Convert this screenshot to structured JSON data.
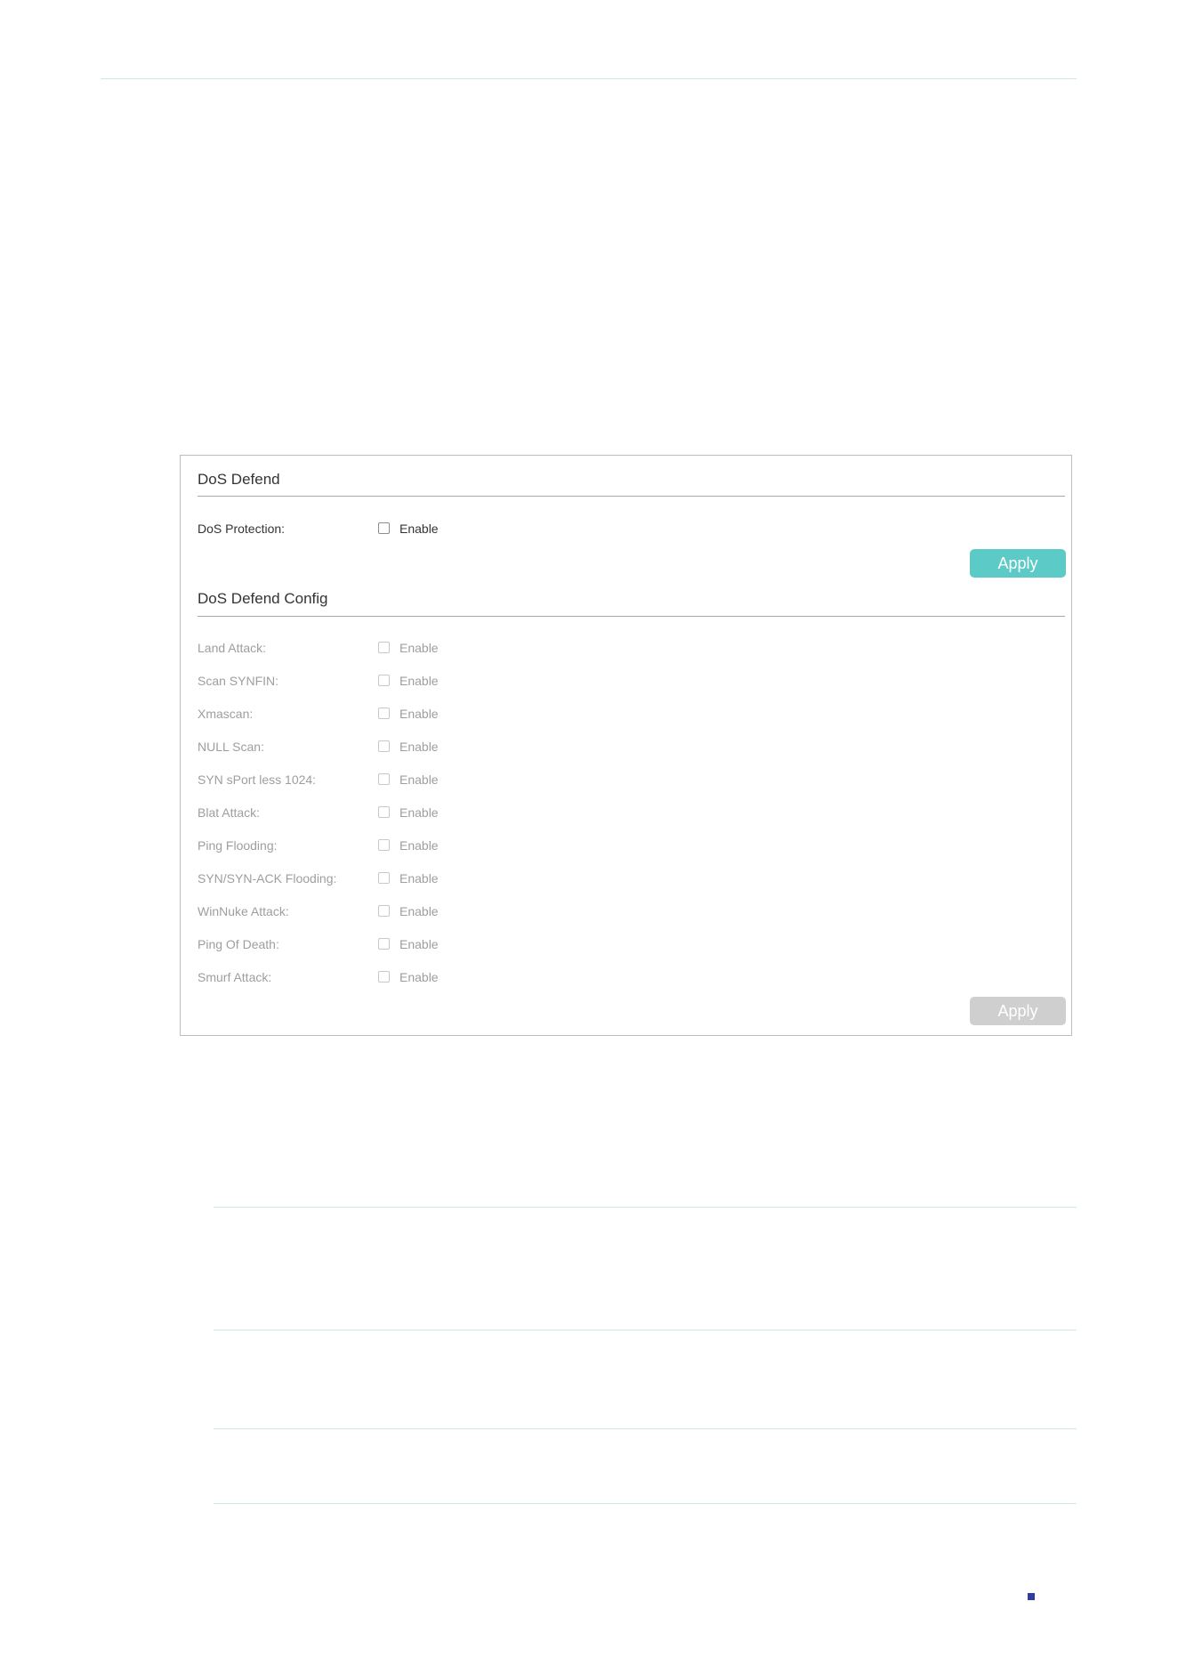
{
  "colors": {
    "accent": "#5ccbc7",
    "disabled_button": "#cfcfcf",
    "divider": "#cfe6ea",
    "page_marker": "#2f3e9e"
  },
  "dos_defend": {
    "title": "DoS Defend",
    "protection": {
      "label": "DoS Protection:",
      "checkbox_label": "Enable",
      "checked": false
    },
    "apply_label": "Apply"
  },
  "dos_defend_config": {
    "title": "DoS Defend Config",
    "items": [
      {
        "label": "Land Attack:",
        "checkbox_label": "Enable",
        "checked": false
      },
      {
        "label": "Scan SYNFIN:",
        "checkbox_label": "Enable",
        "checked": false
      },
      {
        "label": "Xmascan:",
        "checkbox_label": "Enable",
        "checked": false
      },
      {
        "label": "NULL Scan:",
        "checkbox_label": "Enable",
        "checked": false
      },
      {
        "label": "SYN sPort less 1024:",
        "checkbox_label": "Enable",
        "checked": false
      },
      {
        "label": "Blat Attack:",
        "checkbox_label": "Enable",
        "checked": false
      },
      {
        "label": "Ping Flooding:",
        "checkbox_label": "Enable",
        "checked": false
      },
      {
        "label": "SYN/SYN-ACK Flooding:",
        "checkbox_label": "Enable",
        "checked": false
      },
      {
        "label": "WinNuke Attack:",
        "checkbox_label": "Enable",
        "checked": false
      },
      {
        "label": "Ping Of Death:",
        "checkbox_label": "Enable",
        "checked": false
      },
      {
        "label": "Smurf Attack:",
        "checkbox_label": "Enable",
        "checked": false
      }
    ],
    "apply_label": "Apply",
    "apply_disabled": true
  }
}
